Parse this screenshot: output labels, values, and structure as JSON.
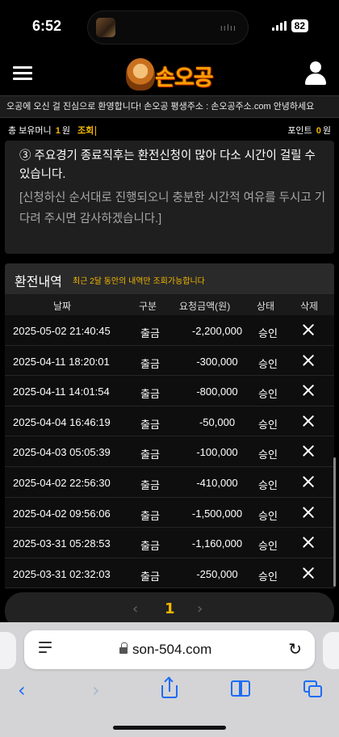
{
  "status": {
    "time": "6:52",
    "battery": "82",
    "wave": "ıılıı"
  },
  "header": {
    "logo_text": "손오공"
  },
  "marquee": "오공에 오신 걸 진심으로 환영합니다! 손오공 평생주소 : 손오공주소.com   안녕하세요",
  "money": {
    "label": "총 보유머니",
    "amount": "1",
    "unit": "원",
    "check_label": "조회",
    "point_label": "포인트",
    "point_amount": "0",
    "point_unit": "원"
  },
  "notice": {
    "main": "③ 주요경기 종료직후는 환전신청이 많아 다소 시간이 걸릴 수 있습니다.",
    "sub": "[신청하신 순서대로 진행되오니 충분한 시간적 여유를 두시고 기다려 주시면 감사하겠습니다.]"
  },
  "history": {
    "title": "환전내역",
    "subtitle": "최근 2달 동안의 내역만 조회가능합니다",
    "columns": [
      "날짜",
      "구분",
      "요청금액(원)",
      "상태",
      "삭제"
    ],
    "rows": [
      {
        "date": "2025-05-02 21:40:45",
        "type": "출금",
        "amount": "-2,200,000",
        "status": "승인"
      },
      {
        "date": "2025-04-11 18:20:01",
        "type": "출금",
        "amount": "-300,000",
        "status": "승인"
      },
      {
        "date": "2025-04-11 14:01:54",
        "type": "출금",
        "amount": "-800,000",
        "status": "승인"
      },
      {
        "date": "2025-04-04 16:46:19",
        "type": "출금",
        "amount": "-50,000",
        "status": "승인"
      },
      {
        "date": "2025-04-03 05:05:39",
        "type": "출금",
        "amount": "-100,000",
        "status": "승인"
      },
      {
        "date": "2025-04-02 22:56:30",
        "type": "출금",
        "amount": "-410,000",
        "status": "승인"
      },
      {
        "date": "2025-04-02 09:56:06",
        "type": "출금",
        "amount": "-1,500,000",
        "status": "승인"
      },
      {
        "date": "2025-03-31 05:28:53",
        "type": "출금",
        "amount": "-1,160,000",
        "status": "승인"
      },
      {
        "date": "2025-03-31 02:32:03",
        "type": "출금",
        "amount": "-250,000",
        "status": "승인"
      }
    ]
  },
  "pager": {
    "prev": "‹",
    "current": "1",
    "next": "›"
  },
  "browser": {
    "url": "son-504.com",
    "reload": "↻",
    "back": "‹",
    "forward": "›"
  },
  "colors": {
    "accent": "#f5b800",
    "link": "#1d6cf5"
  },
  "icons": [
    "hamburger-icon",
    "user-icon",
    "delete-icon",
    "reader-icon",
    "lock-icon",
    "reload-icon",
    "back-icon",
    "forward-icon",
    "share-icon",
    "bookmarks-icon",
    "tabs-icon"
  ]
}
